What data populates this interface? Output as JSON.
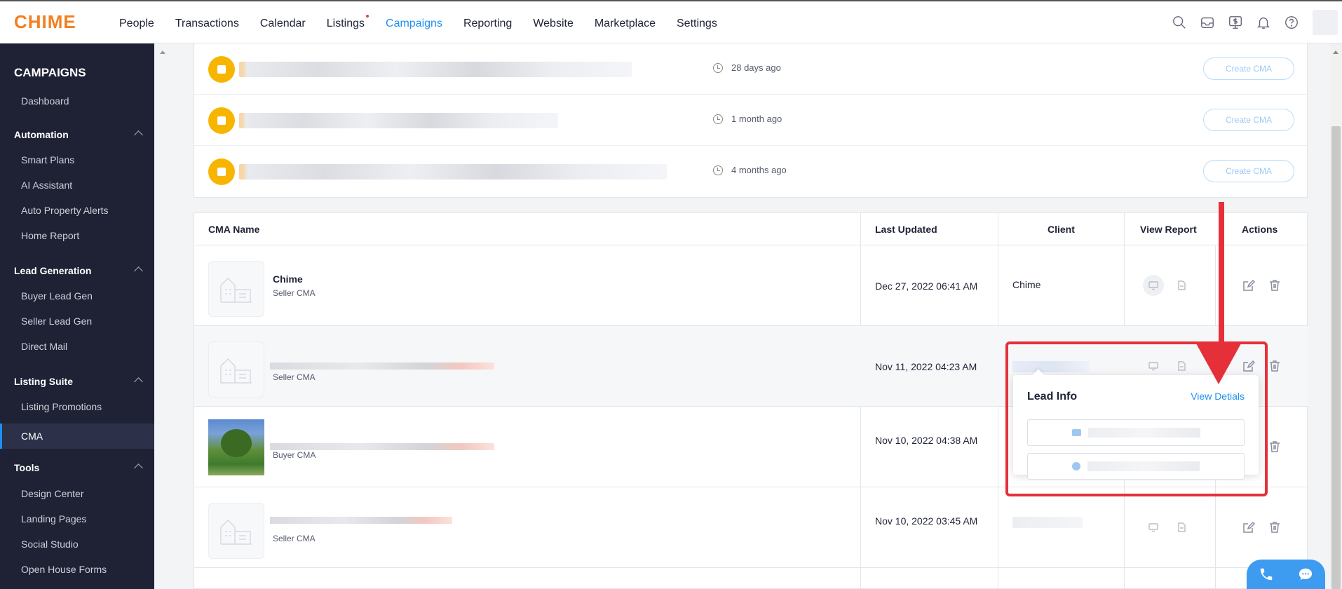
{
  "brand": "CHIME",
  "nav": {
    "links": [
      "People",
      "Transactions",
      "Calendar",
      "Listings",
      "Campaigns",
      "Reporting",
      "Website",
      "Marketplace",
      "Settings"
    ],
    "active": "Campaigns",
    "icons": [
      "search-icon",
      "inbox-icon",
      "dollar-monitor-icon",
      "bell-icon",
      "help-icon"
    ]
  },
  "sidebar": {
    "title": "CAMPAIGNS",
    "dashboard": "Dashboard",
    "groups": [
      {
        "label": "Automation",
        "items": [
          "Smart Plans",
          "AI Assistant",
          "Auto Property Alerts",
          "Home Report"
        ]
      },
      {
        "label": "Lead Generation",
        "items": [
          "Buyer Lead Gen",
          "Seller Lead Gen",
          "Direct Mail"
        ]
      },
      {
        "label": "Listing Suite",
        "items": [
          "Listing Promotions",
          "CMA"
        ]
      },
      {
        "label": "Tools",
        "items": [
          "Design Center",
          "Landing Pages",
          "Social Studio",
          "Open House Forms"
        ]
      }
    ],
    "active": "CMA"
  },
  "suggestions": [
    {
      "time": "28 days ago",
      "button": "Create CMA"
    },
    {
      "time": "1 month ago",
      "button": "Create CMA"
    },
    {
      "time": "4 months ago",
      "button": "Create CMA"
    }
  ],
  "table": {
    "headers": {
      "name": "CMA Name",
      "updated": "Last Updated",
      "client": "Client",
      "report": "View Report",
      "actions": "Actions"
    },
    "rows": [
      {
        "name": "Chime",
        "type": "Seller CMA",
        "date": "Dec 27, 2022 06:41 AM",
        "client": "Chime"
      },
      {
        "name": "",
        "type": "Seller CMA",
        "date": "Nov 11, 2022 04:23 AM",
        "client": ""
      },
      {
        "name": "",
        "type": "Buyer CMA",
        "date": "Nov 10, 2022 04:38 AM",
        "client": ""
      },
      {
        "name": "",
        "type": "Seller CMA",
        "date": "Nov 10, 2022 03:45 AM",
        "client": ""
      }
    ]
  },
  "popover": {
    "title": "Lead Info",
    "link": "View Detials"
  },
  "colors": {
    "brand": "#f47f20",
    "accent": "#1f8ff2",
    "sidebar": "#1f2235",
    "highlight": "#e5303a",
    "house_badge": "#f7b500"
  }
}
